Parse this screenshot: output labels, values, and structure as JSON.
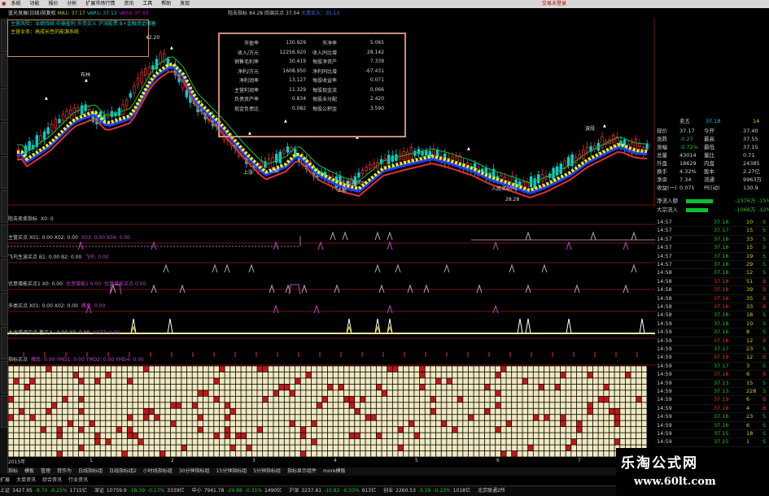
{
  "menubar": {
    "items": [
      "系统",
      "功能",
      "报价",
      "分析",
      "扩展市场行情",
      "资讯",
      "工具",
      "帮助",
      "发现"
    ],
    "trade_label": "交易未登录"
  },
  "chart_title": {
    "name": "蓝光发展(日线)前复权",
    "v1": "MA1: 37.17",
    "v2": "VAR1: 37.13",
    "v3": "VAR4: 37.63"
  },
  "right_title": {
    "left": "阻击指标",
    "mid": "84.28",
    "note": "回调买点",
    "val": "37.04",
    "tail": "大单买入：35.13"
  },
  "notes": {
    "line1": "主营风险：业绩持续 中泰盈利 外资买入 沪深股票 B+金融资金储备",
    "line2": "主营业务：高成长性的能源系统"
  },
  "fin": {
    "rows": [
      [
        "市盈率",
        "130.929",
        "市净率",
        "5.065"
      ],
      [
        "收入/万元",
        "12256.920",
        "收入同比增",
        "28.142"
      ],
      [
        "销售毛利率",
        "30.419",
        "每股净资产",
        "7.339"
      ],
      [
        "净利/万元",
        "1608.950",
        "净利同比增",
        "-67.431"
      ],
      [
        "净利润率",
        "13.127",
        "每股收益率",
        "0.071"
      ],
      [
        "主营利润率",
        "11.329",
        "每股现金流",
        "0.066"
      ],
      [
        "负债资产率",
        "0.834",
        "每股未分配",
        "2.420"
      ],
      [
        "现金负债比",
        "0.082",
        "每股公积金",
        "3.590"
      ]
    ]
  },
  "chart_annotations": {
    "top_high": "42.20",
    "low_mark": "28.28",
    "mid_low": "33.76",
    "label_buy": "入底买60%",
    "label_bb": "布林",
    "label_attack": "波段",
    "label_stop": "止损",
    "label_shang": "上涨"
  },
  "price_axis": [
    "40.00",
    "37.25",
    "35.00",
    "32.50",
    "30.00"
  ],
  "panels": [
    {
      "label": "阻击卖卖指标",
      "vals": "X0: 0"
    },
    {
      "label": "主管买点 X01: 0.00 X02: 0.00",
      "tail": "X03: 0.00  X04: 0.00"
    },
    {
      "label": "飞鸟生波买点 B1: 0.00 B2: 0.00",
      "tail": "飞鸟: 0.00"
    },
    {
      "label": "优意增能买点1 X0: 0.00",
      "tail": "优意增能1 0.00",
      "tail2": "优意增能买点 0.00"
    },
    {
      "label": "多类买点 X01: 0.00 X02: 0.00",
      "tail": "擒卖: 0.00"
    },
    {
      "label": "大龙增调买点 巻买入: 0.00 X0: 0.00",
      "tail": "X077: 0.00"
    },
    {
      "label": "指标买点",
      "tail": "擒底: 0.00  YMD1: 0.00  YMD2: 0.00  YMD4: 0.00"
    }
  ],
  "axis_dates": [
    "2015年",
    "1",
    "2",
    "3",
    "4",
    "5",
    "6",
    "7"
  ],
  "tabs": [
    "指标",
    "模板",
    "管理",
    "耳作为",
    "日线指标组",
    "日线指标组2",
    "小时线指标组",
    "30分钟指标组",
    "15分钟指标组",
    "5分钟指标组",
    "指标显示组件",
    "more模板"
  ],
  "tabs2": [
    "扩展",
    "大单资讯",
    "综合资讯",
    "行业资讯"
  ],
  "status": {
    "items": [
      {
        "label": "上证",
        "val": "3427.95",
        "chg": "-8.70",
        "pct": "-0.25%",
        "amt": "1715亿"
      },
      {
        "label": "深证",
        "val": "10759.9",
        "chg": "-18.39",
        "pct": "-0.17%",
        "amt": "3339亿"
      },
      {
        "label": "中小",
        "val": "7941.78",
        "chg": "-29.88",
        "pct": "-0.31%",
        "amt": "1490亿"
      },
      {
        "label": "沪深",
        "val": "3237.61",
        "chg": "-10.82",
        "pct": "-0.33%",
        "amt": "913亿"
      },
      {
        "label": "创业",
        "val": "2260.53",
        "chg": "-5.19",
        "pct": "-0.23%",
        "amt": "1018亿"
      }
    ],
    "server": "北京联通2所"
  },
  "quote": {
    "sell1": {
      "label": "卖五",
      "price": "37.18",
      "vol": "14"
    },
    "rows": [
      {
        "a": "现价",
        "av": "37.17",
        "b": "今开",
        "bv": "37.40"
      },
      {
        "a": "涨跌",
        "av": "-0.27",
        "b": "最高",
        "bv": "37.55"
      },
      {
        "a": "涨幅",
        "av": "-0.72%",
        "b": "最低",
        "bv": "37.15"
      },
      {
        "a": "总量",
        "av": "43014",
        "b": "量比",
        "bv": "0.71"
      },
      {
        "a": "外盘",
        "av": "18629",
        "b": "内盘",
        "bv": "24385"
      },
      {
        "a": "换手",
        "av": "4.32%",
        "b": "股本",
        "bv": "2.27亿"
      },
      {
        "a": "净资",
        "av": "7.34",
        "b": "流通",
        "bv": "9963万"
      },
      {
        "a": "收益(一)",
        "av": "0.071",
        "b": "PE(动)",
        "bv": "130.9"
      }
    ],
    "flow": [
      {
        "label": "净流入额",
        "val": "-2376万",
        "pct": "-15%",
        "fill": 0.55
      },
      {
        "label": "大宗流入",
        "val": "-1068万",
        "pct": "-12%",
        "fill": 0.45
      }
    ]
  },
  "trades": [
    {
      "t": "14:57",
      "p": "37.18",
      "v": "10",
      "d": "S"
    },
    {
      "t": "14:57",
      "p": "37.17",
      "v": "15",
      "d": "S"
    },
    {
      "t": "14:57",
      "p": "37.18",
      "v": "33",
      "d": "S"
    },
    {
      "t": "14:57",
      "p": "37.18",
      "v": "15",
      "d": "S"
    },
    {
      "t": "14:57",
      "p": "37.18",
      "v": "19",
      "d": "S"
    },
    {
      "t": "14:57",
      "p": "37.18",
      "v": "29",
      "d": "S"
    },
    {
      "t": "14:58",
      "p": "37.18",
      "v": "12",
      "d": "S"
    },
    {
      "t": "14:58",
      "p": "37.18",
      "v": "51",
      "d": "B"
    },
    {
      "t": "14:58",
      "p": "37.18",
      "v": "39",
      "d": "B"
    },
    {
      "t": "14:58",
      "p": "37.18",
      "v": "35",
      "d": "B"
    },
    {
      "t": "14:58",
      "p": "37.18",
      "v": "33",
      "d": "B"
    },
    {
      "t": "14:58",
      "p": "37.18",
      "v": "18",
      "d": "S"
    },
    {
      "t": "14:59",
      "p": "37.18",
      "v": "10",
      "d": "S"
    },
    {
      "t": "14:59",
      "p": "37.16",
      "v": "8",
      "d": "S"
    },
    {
      "t": "14:59",
      "p": "37.18",
      "v": "12",
      "d": "B"
    },
    {
      "t": "14:59",
      "p": "37.17",
      "v": "23",
      "d": "S"
    },
    {
      "t": "14:59",
      "p": "37.19",
      "v": "12",
      "d": "B"
    },
    {
      "t": "14:59",
      "p": "37.17",
      "v": "3",
      "d": "S"
    },
    {
      "t": "14:59",
      "p": "37.18",
      "v": "6",
      "d": "B"
    },
    {
      "t": "14:59",
      "p": "37.13",
      "v": "15",
      "d": "S"
    },
    {
      "t": "14:59",
      "p": "37.13",
      "v": "228",
      "d": "S"
    },
    {
      "t": "14:59",
      "p": "37.19",
      "v": "6",
      "d": "B"
    },
    {
      "t": "14:59",
      "p": "37.18",
      "v": "4",
      "d": "B"
    },
    {
      "t": "14:59",
      "p": "37.16",
      "v": "23",
      "d": "S"
    },
    {
      "t": "14:59",
      "p": "37.16",
      "v": "6",
      "d": "S"
    },
    {
      "t": "14:59",
      "p": "37.15",
      "v": "18",
      "d": "S"
    },
    {
      "t": "14:59",
      "p": "37.15",
      "v": "1",
      "d": "S"
    },
    {
      "t": "14:59",
      "p": "37.15",
      "v": "12",
      "d": "S"
    }
  ],
  "watermark": {
    "title": "乐淘公式网",
    "url": "www.60lt.com"
  },
  "colors": {
    "up": "#e03030",
    "down": "#00c8c8",
    "yellow": "#f0f000",
    "accent": "#c89078"
  }
}
